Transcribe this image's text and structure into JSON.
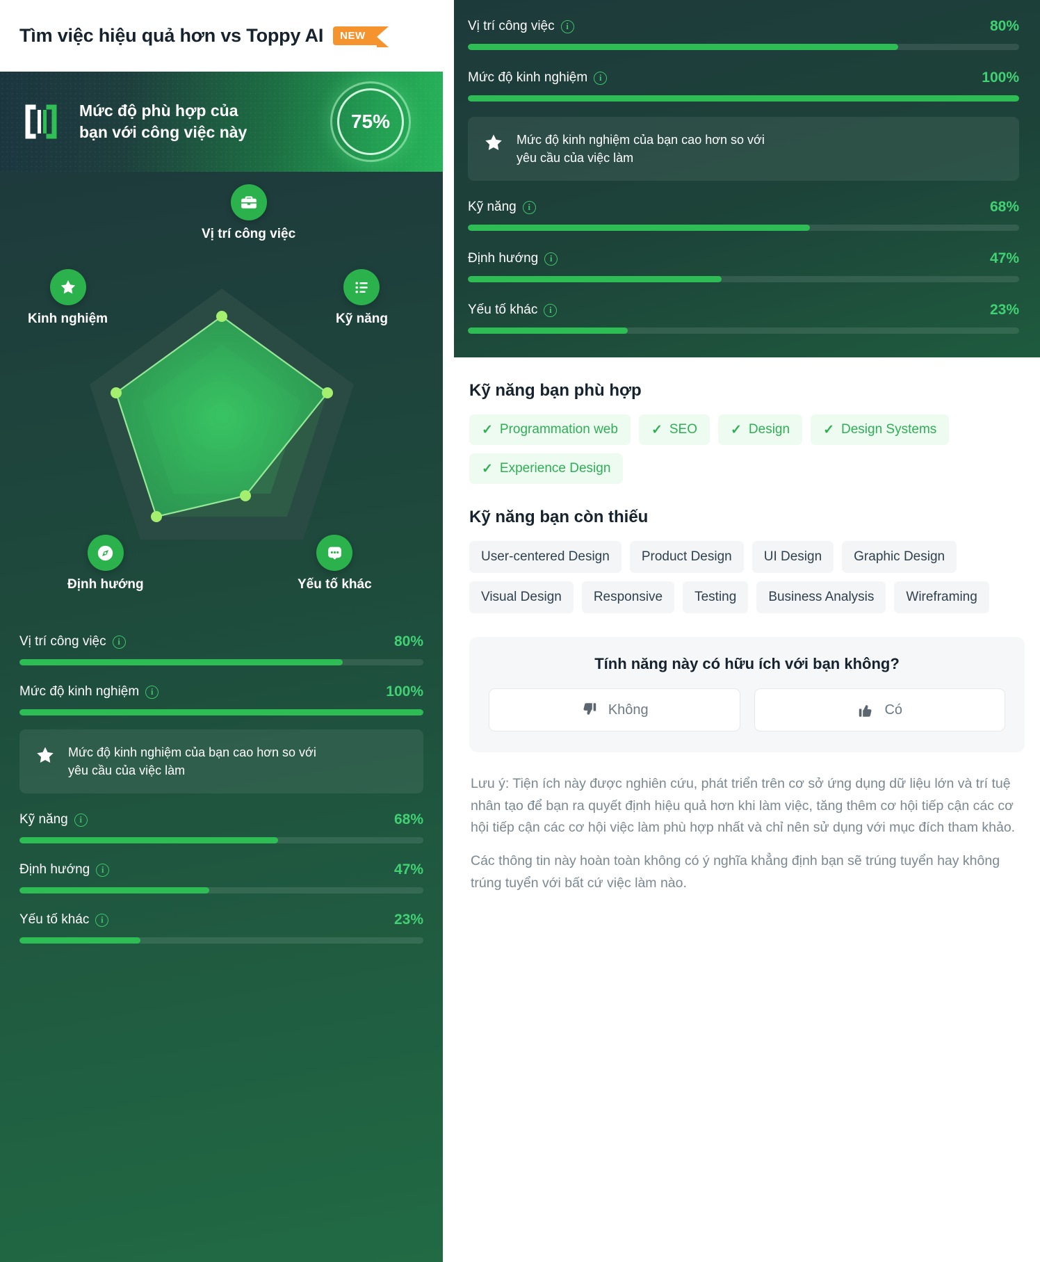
{
  "header": {
    "title": "Tìm việc hiệu quả hơn vs Toppy AI",
    "badge": "NEW"
  },
  "hero": {
    "logo_icon": "toppy-logo-icon",
    "text_line1": "Mức độ phù hợp của",
    "text_line2": "bạn với công việc này",
    "score": "75%",
    "score_value": 75
  },
  "radar": {
    "axes": [
      {
        "label": "Vị trí công việc",
        "icon": "briefcase-icon",
        "value": 80
      },
      {
        "label": "Kỹ năng",
        "icon": "list-check-icon",
        "value": 68
      },
      {
        "label": "Yếu tố khác",
        "icon": "dots-bubble-icon",
        "value": 23
      },
      {
        "label": "Định hướng",
        "icon": "compass-icon",
        "value": 47
      },
      {
        "label": "Kinh nghiệm",
        "icon": "star-icon",
        "value": 100
      }
    ]
  },
  "metrics": [
    {
      "label": "Vị trí công việc",
      "pct": "80%",
      "value": 80
    },
    {
      "label": "Mức độ kinh nghiệm",
      "pct": "100%",
      "value": 100
    },
    {
      "label": "Kỹ năng",
      "pct": "68%",
      "value": 68
    },
    {
      "label": "Định hướng",
      "pct": "47%",
      "value": 47
    },
    {
      "label": "Yếu tố khác",
      "pct": "23%",
      "value": 23
    }
  ],
  "experience_note": {
    "icon": "star-icon",
    "line1": "Mức độ kinh nghiệm của bạn cao hơn so với",
    "line2": "yêu cầu của việc làm",
    "text": "Mức độ kinh nghiệm của bạn cao hơn so với yêu cầu của việc làm"
  },
  "skills_matched": {
    "title": "Kỹ năng bạn phù hợp",
    "check_glyph": "✓",
    "items": [
      "Programmation web",
      "SEO",
      "Design",
      "Design Systems",
      "Experience Design"
    ]
  },
  "skills_missing": {
    "title": "Kỹ năng bạn còn thiếu",
    "items": [
      "User-centered Design",
      "Product Design",
      "UI Design",
      "Graphic Design",
      "Visual Design",
      "Responsive",
      "Testing",
      "Business Analysis",
      "Wireframing"
    ]
  },
  "feedback": {
    "question": "Tính năng này có hữu ích với bạn không?",
    "no_label": "Không",
    "yes_label": "Có",
    "no_icon": "thumbs-down-icon",
    "yes_icon": "thumbs-up-icon"
  },
  "disclaimer": {
    "p1": "Lưu ý: Tiện ích này được nghiên cứu, phát triển trên cơ sở ứng dụng dữ liệu lớn và trí tuệ nhân tạo để bạn ra quyết định hiệu quả hơn khi làm việc, tăng thêm cơ hội tiếp cận các cơ hội tiếp cận các cơ hội việc làm phù hợp nhất và chỉ nên sử dụng với mục đích tham khảo.",
    "p2": "Các thông tin này hoàn toàn không có ý nghĩa khẳng định bạn sẽ trúng tuyển hay không trúng tuyển với bất cứ việc làm nào."
  },
  "colors": {
    "accent_green": "#2dbd54",
    "bright_green": "#41d173",
    "badge_orange": "#f5942e",
    "dark_panel": "#1e3a3c",
    "chip_have_bg": "#eefbf1",
    "chip_miss_bg": "#f4f5f6"
  },
  "chart_data": {
    "type": "radar",
    "title": "Mức độ phù hợp của bạn với công việc này",
    "categories": [
      "Vị trí công việc",
      "Kỹ năng",
      "Yếu tố khác",
      "Định hướng",
      "Kinh nghiệm"
    ],
    "values": [
      80,
      68,
      23,
      47,
      100
    ],
    "range": [
      0,
      100
    ],
    "rings": [
      20,
      40,
      60,
      80,
      100
    ],
    "overall": 75,
    "unit": "%",
    "legend": "none",
    "grid": true
  }
}
